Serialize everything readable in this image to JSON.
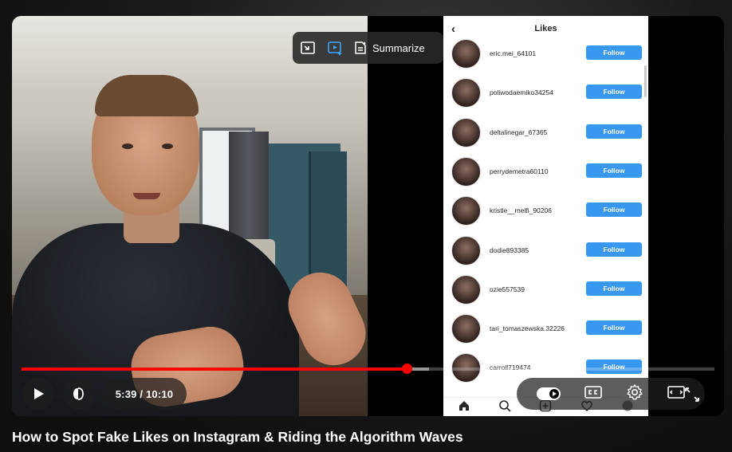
{
  "overlay": {
    "summarize_label": "Summarize"
  },
  "phone": {
    "header_title": "Likes",
    "back_icon": "‹",
    "likes": [
      {
        "name": "eric.mei_64101",
        "follow": "Follow"
      },
      {
        "name": "poliwodaemiko34254",
        "follow": "Follow"
      },
      {
        "name": "deltalinegar_67365",
        "follow": "Follow"
      },
      {
        "name": "perrydemetra60110",
        "follow": "Follow"
      },
      {
        "name": "kristle__melfi_90206",
        "follow": "Follow"
      },
      {
        "name": "dodie893385",
        "follow": "Follow"
      },
      {
        "name": "ozie557539",
        "follow": "Follow"
      },
      {
        "name": "tari_tomaszewska.32226",
        "follow": "Follow"
      },
      {
        "name": "carroll719474",
        "follow": "Follow"
      }
    ],
    "nav_icons": [
      "home-icon",
      "search-icon",
      "add-post-icon",
      "heart-icon",
      "profile-icon"
    ]
  },
  "player": {
    "time_display": "5:39 / 10:10",
    "progress_fraction": 0.556,
    "buffered_fraction": 0.588,
    "accent_color": "#ff0000"
  },
  "video_title": "How to Spot Fake Likes on Instagram & Riding the Algorithm Waves"
}
